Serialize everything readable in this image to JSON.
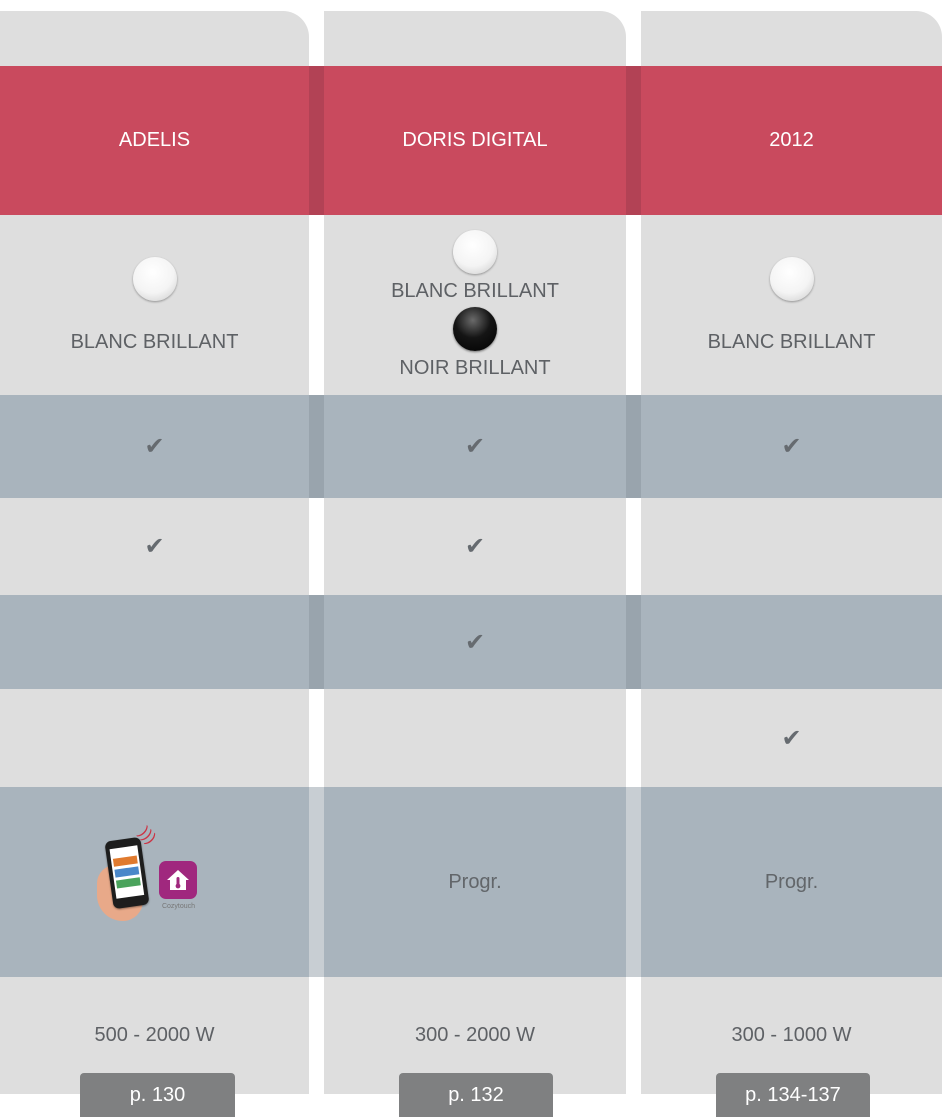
{
  "products": [
    {
      "name": "ADELIS",
      "finishes": [
        {
          "swatch": "white",
          "label": "BLANC BRILLANT"
        }
      ],
      "row1": "✔",
      "row2": "✔",
      "row3": "",
      "row4": "",
      "row5": "",
      "row5_image": "Cozytouch",
      "power": "500 - 2000 W",
      "page": "p. 130"
    },
    {
      "name": "DORIS DIGITAL",
      "finishes": [
        {
          "swatch": "white",
          "label": "BLANC BRILLANT"
        },
        {
          "swatch": "black",
          "label": "NOIR BRILLANT"
        }
      ],
      "row1": "✔",
      "row2": "✔",
      "row3": "✔",
      "row4": "",
      "row5": "Progr.",
      "power": "300 - 2000 W",
      "page": "p. 132"
    },
    {
      "name": "2012",
      "finishes": [
        {
          "swatch": "white",
          "label": "BLANC BRILLANT"
        }
      ],
      "row1": "✔",
      "row2": "",
      "row3": "",
      "row4": "✔",
      "row5": "Progr.",
      "power": "300 - 1000 W",
      "page": "p. 134-137"
    }
  ],
  "colors": {
    "header": "#c94a5e",
    "band": "#a9b4bd",
    "column": "#dedede",
    "tab": "#7f8081"
  }
}
